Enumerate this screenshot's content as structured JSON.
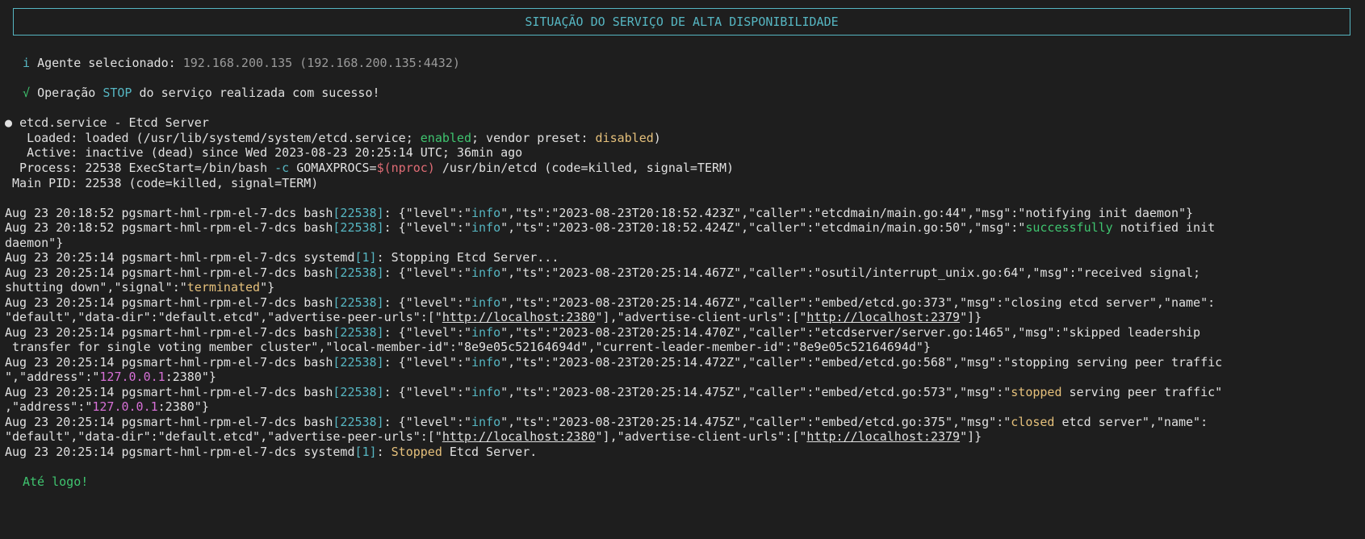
{
  "header": {
    "title": "SITUAÇÃO DO SERVIÇO DE ALTA DISPONIBILIDADE"
  },
  "info": {
    "icon": "i",
    "label": "Agente selecionado:",
    "value": "192.168.200.135 (192.168.200.135:4432)"
  },
  "success": {
    "icon": "√",
    "prefix": "Operação",
    "op": "STOP",
    "suffix": "do serviço realizada com sucesso!"
  },
  "status": {
    "bullet": "●",
    "title": "etcd.service - Etcd Server",
    "loaded_a": "   Loaded: loaded (/usr/lib/systemd/system/etcd.service; ",
    "loaded_enabled": "enabled",
    "loaded_b": "; vendor preset: ",
    "loaded_disabled": "disabled",
    "loaded_c": ")",
    "active": "   Active: inactive (dead) since Wed 2023-08-23 20:25:14 UTC; 36min ago",
    "process_a": "  Process: 22538 ExecStart=/bin/bash ",
    "process_flag": "-c",
    "process_b": " GOMAXPROCS=",
    "process_nproc": "$(nproc)",
    "process_c": " /usr/bin/etcd (code=killed, signal=TERM)",
    "mainpid": " Main PID: 22538 (code=killed, signal=TERM)"
  },
  "log": {
    "l1a": "Aug 23 20:18:52 pgsmart-hml-rpm-el-7-dcs bash",
    "l1b": "[22538]",
    "l1c": ": {\"level\":\"",
    "l1d": "info",
    "l1e": "\",\"ts\":\"2023-08-23T20:18:52.423Z\",\"caller\":\"etcdmain/main.go:44\",\"msg\":\"notifying init daemon\"}",
    "l2a": "Aug 23 20:18:52 pgsmart-hml-rpm-el-7-dcs bash",
    "l2b": "[22538]",
    "l2c": ": {\"level\":\"",
    "l2d": "info",
    "l2e": "\",\"ts\":\"2023-08-23T20:18:52.424Z\",\"caller\":\"etcdmain/main.go:50\",\"msg\":\"",
    "l2f": "successfully",
    "l2g": " notified init",
    "l2h": "daemon\"}",
    "l3a": "Aug 23 20:25:14 pgsmart-hml-rpm-el-7-dcs systemd",
    "l3b": "[1]",
    "l3c": ": Stopping Etcd Server...",
    "l4a": "Aug 23 20:25:14 pgsmart-hml-rpm-el-7-dcs bash",
    "l4b": "[22538]",
    "l4c": ": {\"level\":\"",
    "l4d": "info",
    "l4e": "\",\"ts\":\"2023-08-23T20:25:14.467Z\",\"caller\":\"osutil/interrupt_unix.go:64\",\"msg\":\"received signal;",
    "l4f": "shutting down\",\"signal\":\"",
    "l4g": "terminated",
    "l4h": "\"}",
    "l5a": "Aug 23 20:25:14 pgsmart-hml-rpm-el-7-dcs bash",
    "l5b": "[22538]",
    "l5c": ": {\"level\":\"",
    "l5d": "info",
    "l5e": "\",\"ts\":\"2023-08-23T20:25:14.467Z\",\"caller\":\"embed/etcd.go:373\",\"msg\":\"closing etcd server\",\"name\":",
    "l5f": "\"default\",\"data-dir\":\"default.etcd\",\"advertise-peer-urls\":[\"",
    "l5g": "http://localhost:2380",
    "l5h": "\"],\"advertise-client-urls\":[\"",
    "l5i": "http://localhost:2379",
    "l5j": "\"]}",
    "l6a": "Aug 23 20:25:14 pgsmart-hml-rpm-el-7-dcs bash",
    "l6b": "[22538]",
    "l6c": ": {\"level\":\"",
    "l6d": "info",
    "l6e": "\",\"ts\":\"2023-08-23T20:25:14.470Z\",\"caller\":\"etcdserver/server.go:1465\",\"msg\":\"skipped leadership",
    "l6f": " transfer for single voting member cluster\",\"local-member-id\":\"8e9e05c52164694d\",\"current-leader-member-id\":\"8e9e05c52164694d\"}",
    "l7a": "Aug 23 20:25:14 pgsmart-hml-rpm-el-7-dcs bash",
    "l7b": "[22538]",
    "l7c": ": {\"level\":\"",
    "l7d": "info",
    "l7e": "\",\"ts\":\"2023-08-23T20:25:14.472Z\",\"caller\":\"embed/etcd.go:568\",\"msg\":\"stopping serving peer traffic",
    "l7f": "\",\"address\":\"",
    "l7g": "127.0.0.1",
    "l7h": ":2380\"}",
    "l8a": "Aug 23 20:25:14 pgsmart-hml-rpm-el-7-dcs bash",
    "l8b": "[22538]",
    "l8c": ": {\"level\":\"",
    "l8d": "info",
    "l8e": "\",\"ts\":\"2023-08-23T20:25:14.475Z\",\"caller\":\"embed/etcd.go:573\",\"msg\":\"",
    "l8f": "stopped",
    "l8g": " serving peer traffic\"",
    "l8h": ",\"address\":\"",
    "l8i": "127.0.0.1",
    "l8j": ":2380\"}",
    "l9a": "Aug 23 20:25:14 pgsmart-hml-rpm-el-7-dcs bash",
    "l9b": "[22538]",
    "l9c": ": {\"level\":\"",
    "l9d": "info",
    "l9e": "\",\"ts\":\"2023-08-23T20:25:14.475Z\",\"caller\":\"embed/etcd.go:375\",\"msg\":\"",
    "l9f": "closed",
    "l9g": " etcd server\",\"name\":",
    "l9h": "\"default\",\"data-dir\":\"default.etcd\",\"advertise-peer-urls\":[\"",
    "l9i": "http://localhost:2380",
    "l9j": "\"],\"advertise-client-urls\":[\"",
    "l9k": "http://localhost:2379",
    "l9l": "\"]}",
    "l10a": "Aug 23 20:25:14 pgsmart-hml-rpm-el-7-dcs systemd",
    "l10b": "[1]",
    "l10c": ": ",
    "l10d": "Stopped",
    "l10e": " Etcd Server."
  },
  "footer": {
    "goodbye": "Até logo!"
  }
}
